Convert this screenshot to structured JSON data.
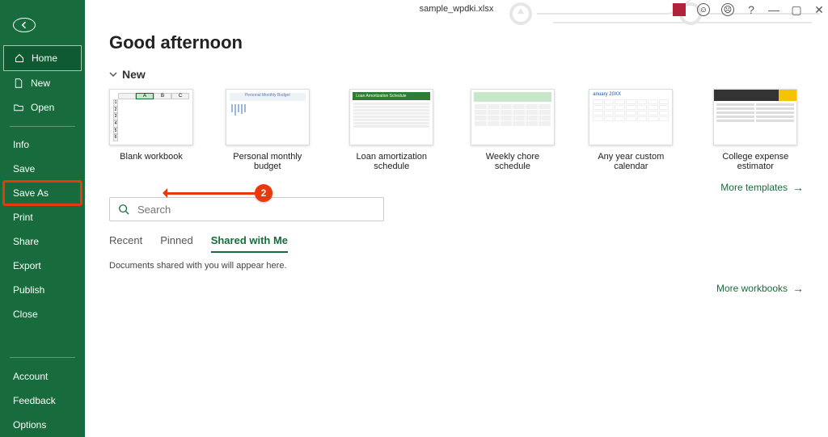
{
  "titlebar": {
    "filename": "sample_wpdki.xlsx"
  },
  "sidebar": {
    "home": "Home",
    "new": "New",
    "open": "Open",
    "info": "Info",
    "save": "Save",
    "save_as": "Save As",
    "print": "Print",
    "share": "Share",
    "export": "Export",
    "publish": "Publish",
    "close": "Close",
    "account": "Account",
    "feedback": "Feedback",
    "options": "Options"
  },
  "main": {
    "greeting": "Good afternoon",
    "new_section": "New",
    "templates": {
      "blank": "Blank workbook",
      "budget": "Personal monthly budget",
      "loan": "Loan amortization schedule",
      "chore": "Weekly chore schedule",
      "calendar": "Any year custom calendar",
      "college": "College expense estimator"
    },
    "more_templates": "More templates",
    "search_placeholder": "Search",
    "tabs": {
      "recent": "Recent",
      "pinned": "Pinned",
      "shared": "Shared with Me"
    },
    "shared_empty": "Documents shared with you will appear here.",
    "more_workbooks": "More workbooks"
  },
  "annotation": {
    "step": "2"
  },
  "thumb_text": {
    "cal_header": "anuary 20XX",
    "loan_header": "Loan Amortization Schedule",
    "budget_header": "Personal Monthly Budget"
  }
}
